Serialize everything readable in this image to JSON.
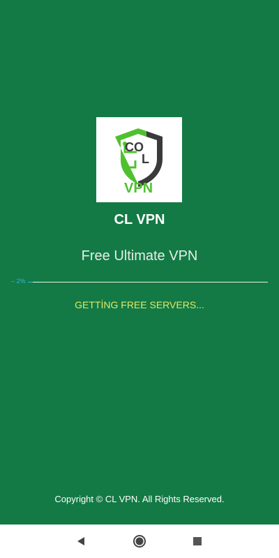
{
  "app": {
    "logo_text_top": "CO",
    "logo_text_mid": "L",
    "logo_text_bottom": "VPN",
    "name": "CL VPN",
    "tagline": "Free Ultimate VPN"
  },
  "loading": {
    "progress_label": "2%",
    "progress_fraction": 0.02,
    "status_text": "GETTİNG FREE SERVERS..."
  },
  "footer": {
    "copyright": "Copyright © CL VPN. All Rights Reserved."
  },
  "navigation": {
    "back_icon": "back-triangle-icon",
    "home_icon": "home-circle-icon",
    "recent_icon": "recent-square-icon"
  },
  "colors": {
    "background": "#137a45",
    "logo_green": "#4fc12f",
    "logo_dark": "#3a3a3a",
    "progress": "#33b5e5",
    "status": "#e3e867"
  }
}
